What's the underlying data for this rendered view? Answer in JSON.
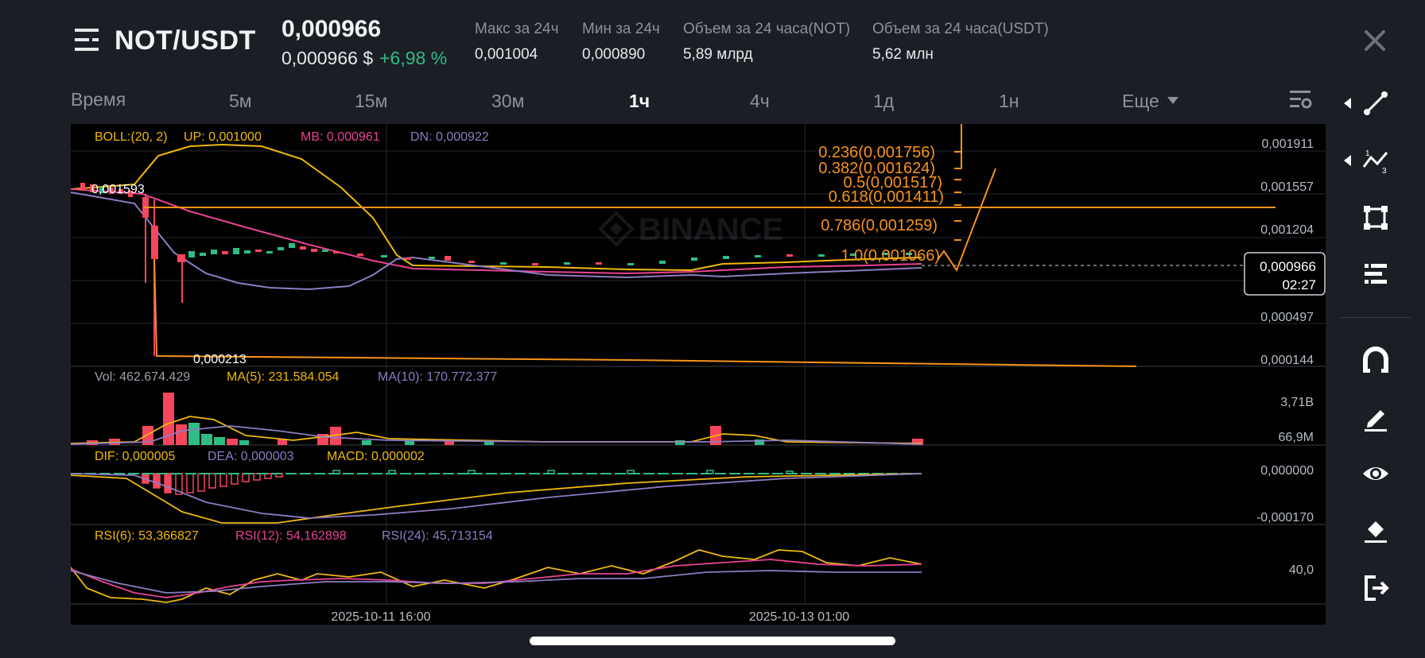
{
  "header": {
    "pair": "NOT/USDT",
    "price": "0,000966",
    "price_usd": "0,000966 $",
    "change": "+6,98 %",
    "stats": [
      {
        "label": "Макс за 24ч",
        "value": "0,001004"
      },
      {
        "label": "Мин за 24ч",
        "value": "0,000890"
      },
      {
        "label": "Объем за 24 часа(NOT)",
        "value": "5,89 млрд"
      },
      {
        "label": "Объем за 24 часа(USDT)",
        "value": "5,62 млн"
      }
    ]
  },
  "timeframes": {
    "items": [
      "Время",
      "5м",
      "15м",
      "30м",
      "1ч",
      "4ч",
      "1д",
      "1н"
    ],
    "more": "Еще",
    "active": "1ч"
  },
  "chart": {
    "watermark": "BINANCE",
    "boll": {
      "label": "BOLL:(20, 2)",
      "up": "UP: 0,001000",
      "mb": "MB: 0,000961",
      "dn": "DN: 0,000922"
    },
    "price_axis": [
      "0,001911",
      "0,001557",
      "0,001204",
      "0,000497",
      "0,000144"
    ],
    "current_price": "0,000966",
    "countdown": "02:27",
    "high_label": "0,001593",
    "low_label": "0,000213",
    "fib_levels": [
      "0.236(0,001756)",
      "0.382(0,001624)",
      "0.5(0,001517)",
      "0.618(0,001411)",
      "0.786(0,001259)",
      "1.0(0,001066)"
    ],
    "volume": {
      "vol": "Vol: 462.674.429",
      "ma5": "MA(5): 231.584.054",
      "ma10": "MA(10): 170.772.377",
      "axis_top": "3,71B",
      "axis_bottom": "66,9M"
    },
    "macd": {
      "dif": "DIF: 0,000005",
      "dea": "DEA: 0,000003",
      "macd": "MACD: 0,000002",
      "axis_top": "0,000000",
      "axis_bottom": "-0,000170"
    },
    "rsi": {
      "rsi6": "RSI(6): 53,366827",
      "rsi12": "RSI(12): 54,162898",
      "rsi24": "RSI(24): 45,713154",
      "axis": "40,0"
    },
    "time_axis": [
      "2025-10-11 16:00",
      "2025-10-13 01:00"
    ]
  },
  "colors": {
    "up": "#2ebd85",
    "down": "#f6465d",
    "yellow": "#f0b90b",
    "pink": "#e84393",
    "purple": "#8e7cc3",
    "fib": "#f7931a",
    "background": "#000000"
  },
  "toolbar_icons": [
    "trend-line-icon",
    "fib-icon",
    "rectangle-icon",
    "indicator-icon",
    "magnet-icon",
    "pencil-icon",
    "eye-icon",
    "eraser-icon",
    "exit-icon"
  ]
}
